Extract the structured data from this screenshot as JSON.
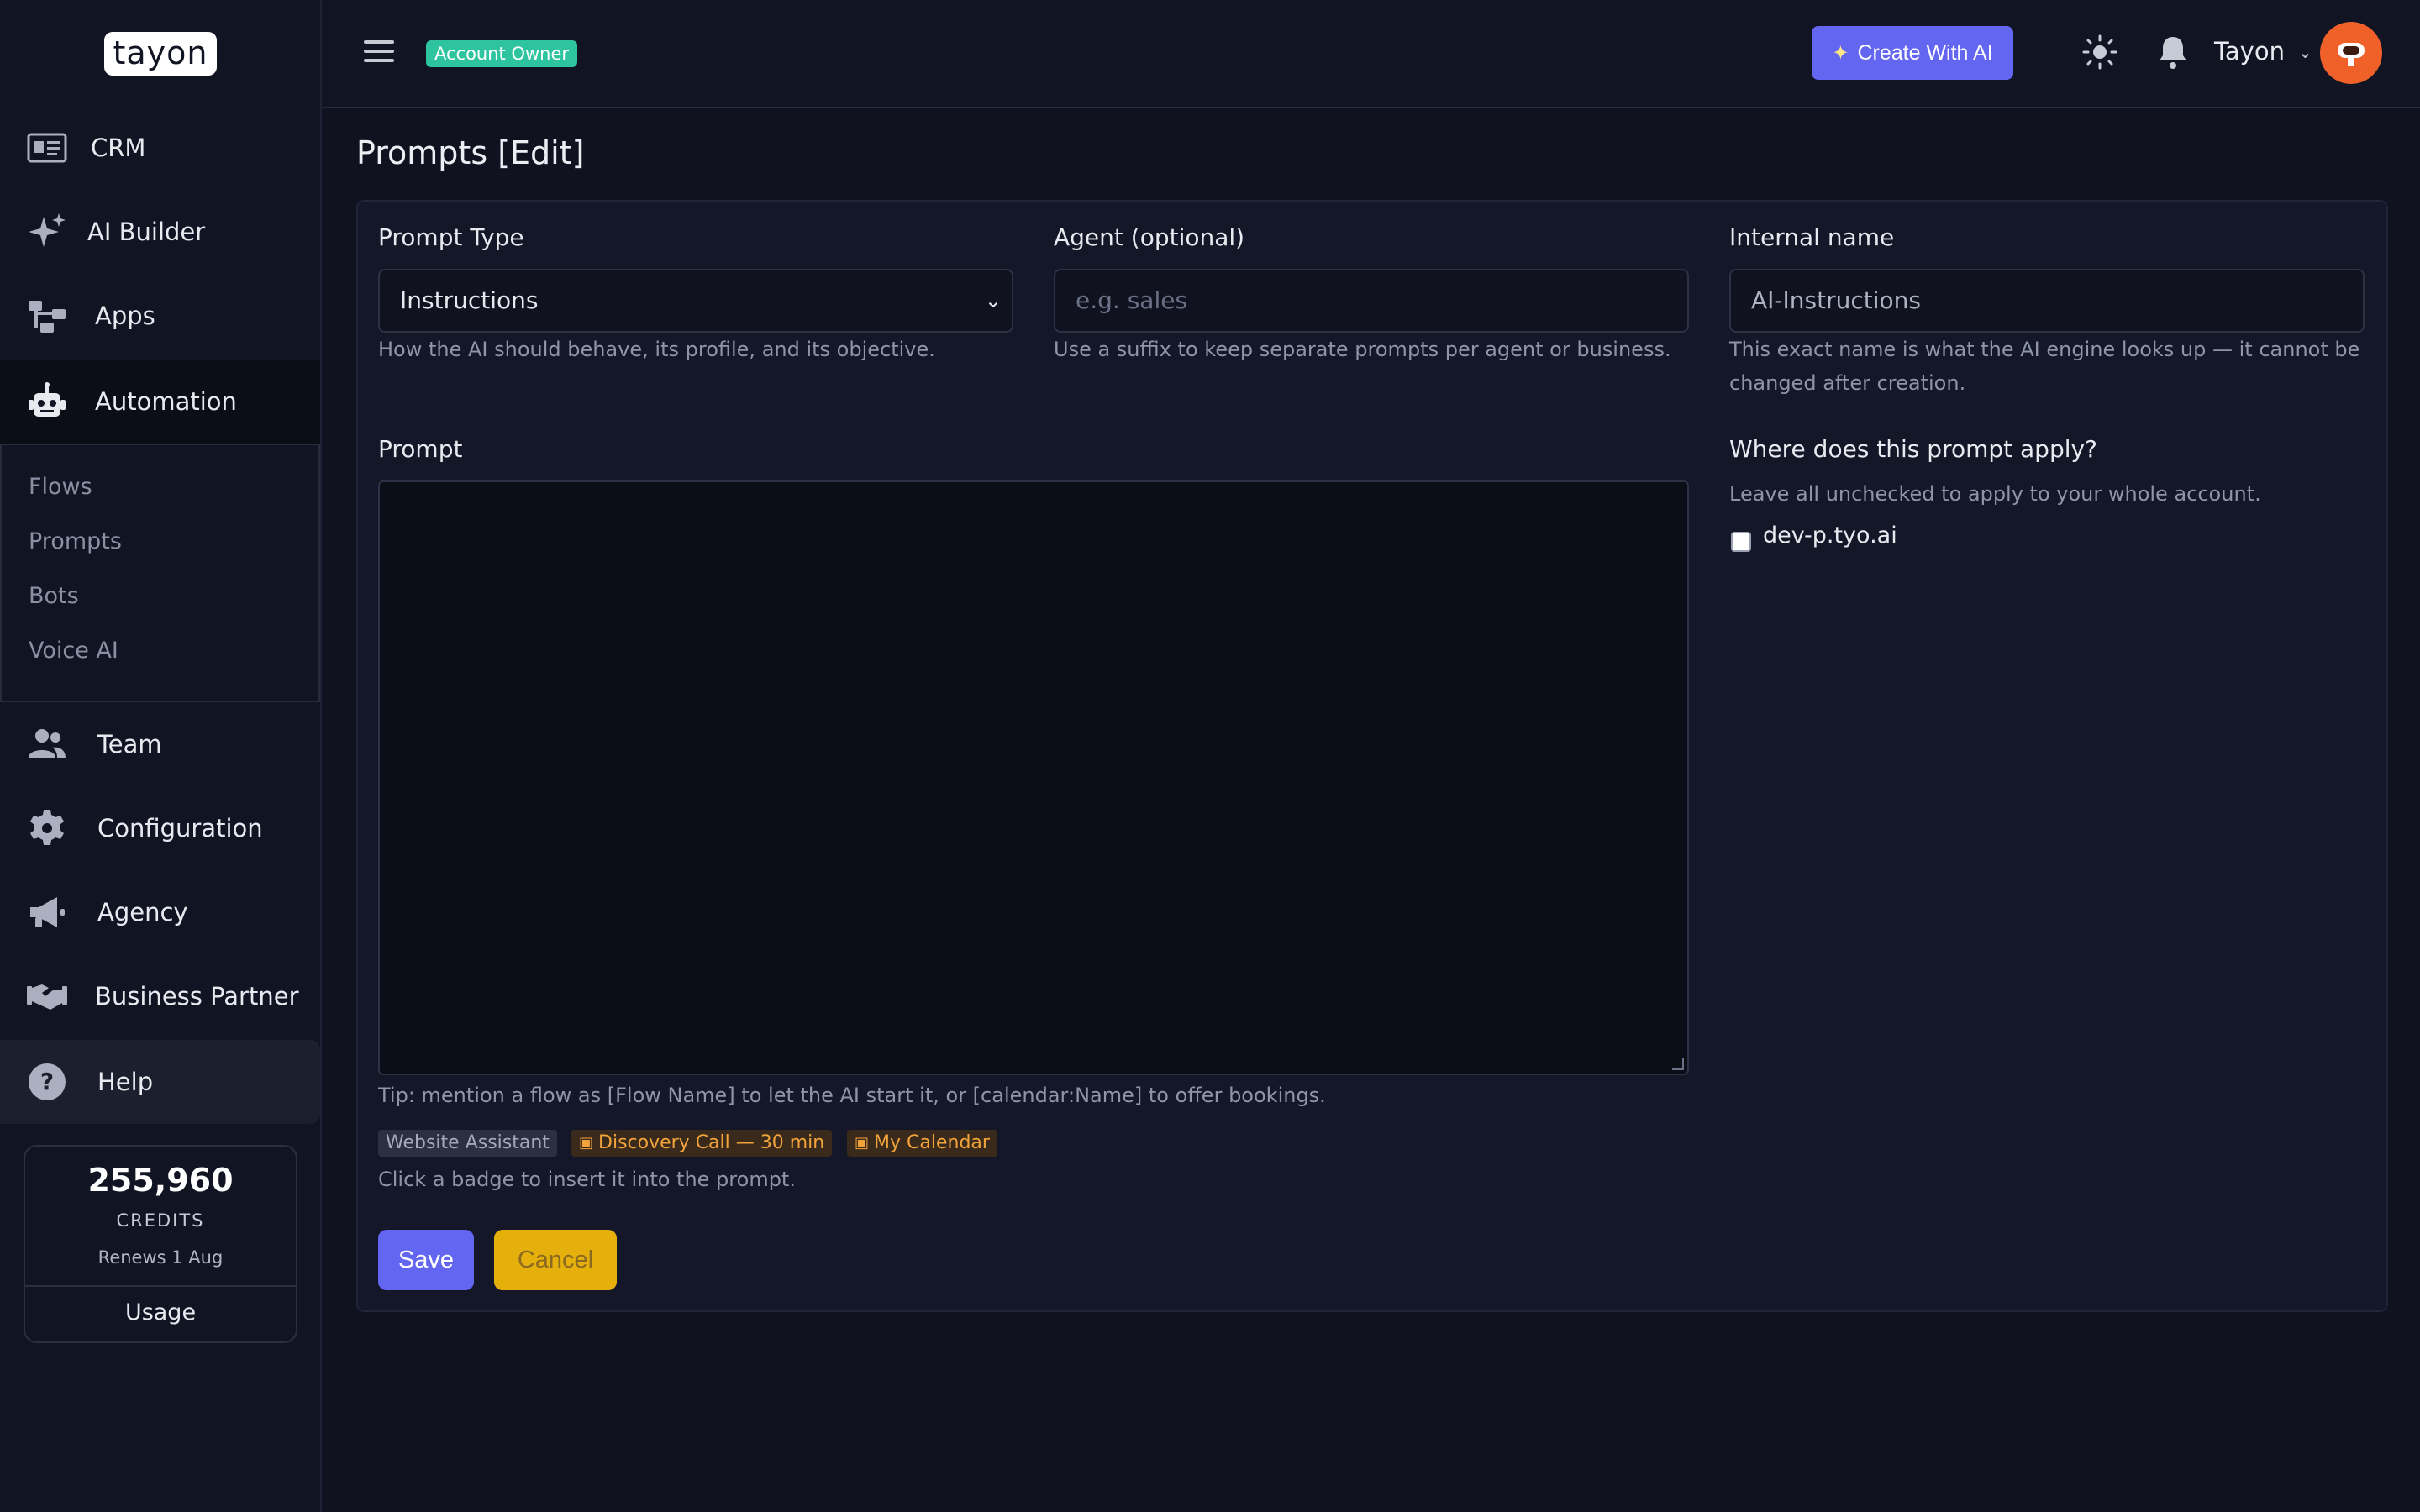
{
  "brand": {
    "logo_text": "tayon"
  },
  "sidebar": {
    "items": [
      {
        "label": "CRM",
        "icon": "id-card-icon"
      },
      {
        "label": "AI Builder",
        "icon": "sparkles-icon"
      },
      {
        "label": "Apps",
        "icon": "sitemap-icon"
      },
      {
        "label": "Automation",
        "icon": "robot-icon"
      },
      {
        "label": "Team",
        "icon": "users-icon"
      },
      {
        "label": "Configuration",
        "icon": "gear-icon"
      },
      {
        "label": "Agency",
        "icon": "megaphone-icon"
      },
      {
        "label": "Business Partner",
        "icon": "handshake-icon"
      },
      {
        "label": "Help",
        "icon": "question-circle-icon"
      }
    ],
    "submenu": [
      "Flows",
      "Prompts",
      "Bots",
      "Voice AI"
    ],
    "credits": {
      "amount": "255,960",
      "label": "CREDITS",
      "renews": "Renews 1 Aug",
      "usage_label": "Usage"
    }
  },
  "topbar": {
    "role_badge": "Account Owner",
    "create_ai_label": "Create With AI",
    "user_name": "Tayon"
  },
  "main": {
    "title": "Prompts [Edit]",
    "prompt_type": {
      "label": "Prompt Type",
      "selected": "Instructions",
      "hint": "How the AI should behave, its profile, and its objective."
    },
    "agent": {
      "label": "Agent (optional)",
      "placeholder": "e.g. sales",
      "hint": "Use a suffix to keep separate prompts per agent or business."
    },
    "internal_name": {
      "label": "Internal name",
      "value": "AI-Instructions",
      "hint_line1": "This exact name is what the AI engine looks up — it cannot be",
      "hint_line2": "changed after creation."
    },
    "prompt": {
      "label": "Prompt",
      "value": "",
      "tip": "Tip: mention a flow as [Flow Name] to let the AI start it, or [calendar:Name] to offer bookings.",
      "badges": [
        "Website Assistant",
        "Discovery Call — 30 min",
        "My Calendar"
      ],
      "badge_hint": "Click a badge to insert it into the prompt."
    },
    "apply": {
      "label": "Where does this prompt apply?",
      "hint": "Leave all unchecked to apply to your whole account.",
      "options": [
        {
          "label": "dev-p.tyo.ai",
          "checked": false
        }
      ]
    },
    "save_label": "Save",
    "cancel_label": "Cancel"
  },
  "colors": {
    "accent": "#6366f1",
    "warning": "#e6b00c",
    "success": "#2ec4a0",
    "avatar": "#f0612a"
  }
}
